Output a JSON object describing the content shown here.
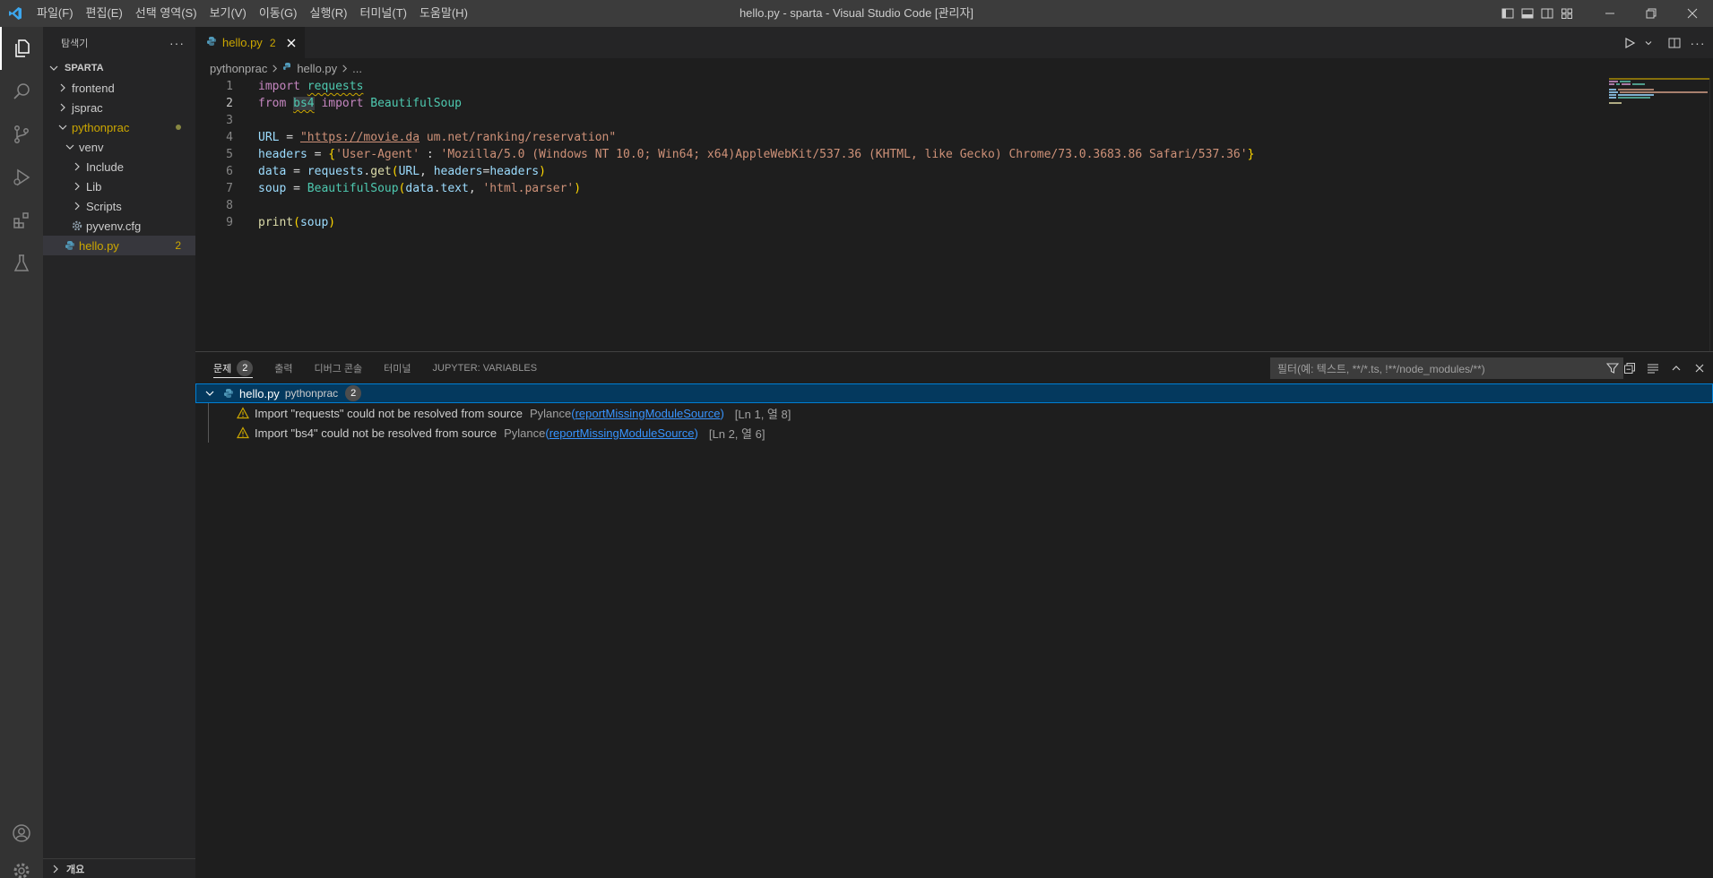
{
  "titlebar": {
    "menu": [
      "파일(F)",
      "편집(E)",
      "선택 영역(S)",
      "보기(V)",
      "이동(G)",
      "실행(R)",
      "터미널(T)",
      "도움말(H)"
    ],
    "window_title": "hello.py - sparta - Visual Studio Code [관리자]"
  },
  "sidebar": {
    "title": "탐색기",
    "section": "SPARTA",
    "items": [
      {
        "label": "frontend"
      },
      {
        "label": "jsprac"
      },
      {
        "label": "pythonprac"
      },
      {
        "label": "venv"
      },
      {
        "label": "Include"
      },
      {
        "label": "Lib"
      },
      {
        "label": "Scripts"
      },
      {
        "label": "pyvenv.cfg"
      },
      {
        "label": "hello.py",
        "badge": "2"
      }
    ],
    "footer": "개요"
  },
  "editor": {
    "tab": {
      "label": "hello.py",
      "badge": "2"
    },
    "breadcrumb": {
      "folder": "pythonprac",
      "file": "hello.py",
      "more": "..."
    },
    "line_numbers": [
      "1",
      "2",
      "3",
      "4",
      "5",
      "6",
      "7",
      "8",
      "9"
    ],
    "code": {
      "l1_kw": "import",
      "l1_mod": "requests",
      "l2_kw1": "from",
      "l2_mod": "bs4",
      "l2_kw2": "import",
      "l2_cls": "BeautifulSoup",
      "l4_var": "URL",
      "l4_op": " = ",
      "l4_str_a": "\"https://movie.da",
      "l4_str_b": " um.net/ranking/reservation\"",
      "l5_var": "headers",
      "l5_op": " = ",
      "l5_open": "{",
      "l5_key": "'User-Agent'",
      "l5_colon": " : ",
      "l5_val": "'Mozilla/5.0 (Windows NT 10.0; Win64; x64)AppleWebKit/537.36 (KHTML, like Gecko) Chrome/73.0.3683.86 Safari/537.36'",
      "l5_close": "}",
      "l6_var": "data",
      "l6_op": " = ",
      "l6_obj": "requests",
      "l6_dot": ".",
      "l6_fn": "get",
      "l6_open": "(",
      "l6_arg1": "URL",
      "l6_comma": ", ",
      "l6_kwarg": "headers",
      "l6_eq": "=",
      "l6_arg2": "headers",
      "l6_close": ")",
      "l7_var": "soup",
      "l7_op": " = ",
      "l7_cls": "BeautifulSoup",
      "l7_open": "(",
      "l7_arg1": "data",
      "l7_dot": ".",
      "l7_attr": "text",
      "l7_comma": ", ",
      "l7_str": "'html.parser'",
      "l7_close": ")",
      "l9_fn": "print",
      "l9_open": "(",
      "l9_arg": "soup",
      "l9_close": ")"
    }
  },
  "panel": {
    "tabs": [
      {
        "label": "문제",
        "count": "2"
      },
      {
        "label": "출력"
      },
      {
        "label": "디버그 콘솔"
      },
      {
        "label": "터미널"
      },
      {
        "label": "JUPYTER: VARIABLES"
      }
    ],
    "filter_placeholder": "필터(예: 텍스트, **/*.ts, !**/node_modules/**)",
    "problem_file": {
      "name": "hello.py",
      "path": "pythonprac",
      "count": "2"
    },
    "problems": [
      {
        "message": "Import \"requests\" could not be resolved from source",
        "source": "Pylance",
        "open": "(",
        "code": "reportMissingModuleSource",
        "close": ")",
        "location": "[Ln 1, 열 8]"
      },
      {
        "message": "Import \"bs4\" could not be resolved from source",
        "source": "Pylance",
        "open": "(",
        "code": "reportMissingModuleSource",
        "close": ")",
        "location": "[Ln 2, 열 6]"
      }
    ]
  },
  "colors": {
    "accent": "#007acc",
    "warning": "#cca700",
    "link": "#3794ff"
  }
}
